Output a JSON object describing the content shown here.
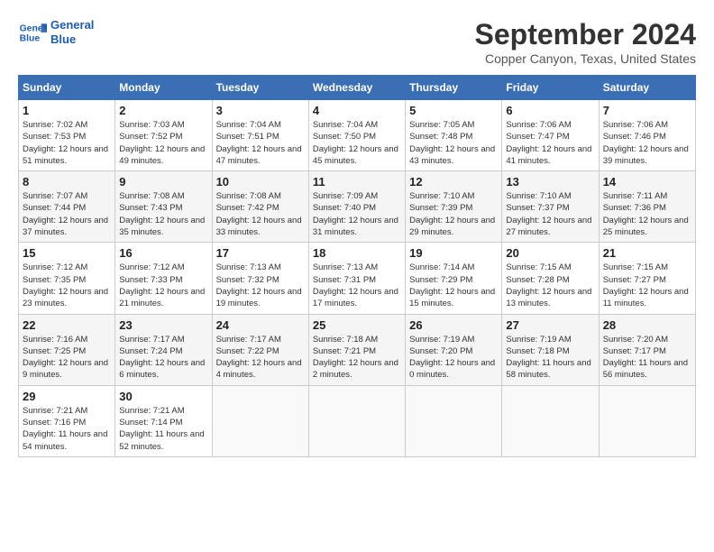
{
  "header": {
    "logo_line1": "General",
    "logo_line2": "Blue",
    "title": "September 2024",
    "location": "Copper Canyon, Texas, United States"
  },
  "days_of_week": [
    "Sunday",
    "Monday",
    "Tuesday",
    "Wednesday",
    "Thursday",
    "Friday",
    "Saturday"
  ],
  "weeks": [
    [
      {
        "num": "1",
        "sunrise": "7:02 AM",
        "sunset": "7:53 PM",
        "daylight": "12 hours and 51 minutes."
      },
      {
        "num": "2",
        "sunrise": "7:03 AM",
        "sunset": "7:52 PM",
        "daylight": "12 hours and 49 minutes."
      },
      {
        "num": "3",
        "sunrise": "7:04 AM",
        "sunset": "7:51 PM",
        "daylight": "12 hours and 47 minutes."
      },
      {
        "num": "4",
        "sunrise": "7:04 AM",
        "sunset": "7:50 PM",
        "daylight": "12 hours and 45 minutes."
      },
      {
        "num": "5",
        "sunrise": "7:05 AM",
        "sunset": "7:48 PM",
        "daylight": "12 hours and 43 minutes."
      },
      {
        "num": "6",
        "sunrise": "7:06 AM",
        "sunset": "7:47 PM",
        "daylight": "12 hours and 41 minutes."
      },
      {
        "num": "7",
        "sunrise": "7:06 AM",
        "sunset": "7:46 PM",
        "daylight": "12 hours and 39 minutes."
      }
    ],
    [
      {
        "num": "8",
        "sunrise": "7:07 AM",
        "sunset": "7:44 PM",
        "daylight": "12 hours and 37 minutes."
      },
      {
        "num": "9",
        "sunrise": "7:08 AM",
        "sunset": "7:43 PM",
        "daylight": "12 hours and 35 minutes."
      },
      {
        "num": "10",
        "sunrise": "7:08 AM",
        "sunset": "7:42 PM",
        "daylight": "12 hours and 33 minutes."
      },
      {
        "num": "11",
        "sunrise": "7:09 AM",
        "sunset": "7:40 PM",
        "daylight": "12 hours and 31 minutes."
      },
      {
        "num": "12",
        "sunrise": "7:10 AM",
        "sunset": "7:39 PM",
        "daylight": "12 hours and 29 minutes."
      },
      {
        "num": "13",
        "sunrise": "7:10 AM",
        "sunset": "7:37 PM",
        "daylight": "12 hours and 27 minutes."
      },
      {
        "num": "14",
        "sunrise": "7:11 AM",
        "sunset": "7:36 PM",
        "daylight": "12 hours and 25 minutes."
      }
    ],
    [
      {
        "num": "15",
        "sunrise": "7:12 AM",
        "sunset": "7:35 PM",
        "daylight": "12 hours and 23 minutes."
      },
      {
        "num": "16",
        "sunrise": "7:12 AM",
        "sunset": "7:33 PM",
        "daylight": "12 hours and 21 minutes."
      },
      {
        "num": "17",
        "sunrise": "7:13 AM",
        "sunset": "7:32 PM",
        "daylight": "12 hours and 19 minutes."
      },
      {
        "num": "18",
        "sunrise": "7:13 AM",
        "sunset": "7:31 PM",
        "daylight": "12 hours and 17 minutes."
      },
      {
        "num": "19",
        "sunrise": "7:14 AM",
        "sunset": "7:29 PM",
        "daylight": "12 hours and 15 minutes."
      },
      {
        "num": "20",
        "sunrise": "7:15 AM",
        "sunset": "7:28 PM",
        "daylight": "12 hours and 13 minutes."
      },
      {
        "num": "21",
        "sunrise": "7:15 AM",
        "sunset": "7:27 PM",
        "daylight": "12 hours and 11 minutes."
      }
    ],
    [
      {
        "num": "22",
        "sunrise": "7:16 AM",
        "sunset": "7:25 PM",
        "daylight": "12 hours and 9 minutes."
      },
      {
        "num": "23",
        "sunrise": "7:17 AM",
        "sunset": "7:24 PM",
        "daylight": "12 hours and 6 minutes."
      },
      {
        "num": "24",
        "sunrise": "7:17 AM",
        "sunset": "7:22 PM",
        "daylight": "12 hours and 4 minutes."
      },
      {
        "num": "25",
        "sunrise": "7:18 AM",
        "sunset": "7:21 PM",
        "daylight": "12 hours and 2 minutes."
      },
      {
        "num": "26",
        "sunrise": "7:19 AM",
        "sunset": "7:20 PM",
        "daylight": "12 hours and 0 minutes."
      },
      {
        "num": "27",
        "sunrise": "7:19 AM",
        "sunset": "7:18 PM",
        "daylight": "11 hours and 58 minutes."
      },
      {
        "num": "28",
        "sunrise": "7:20 AM",
        "sunset": "7:17 PM",
        "daylight": "11 hours and 56 minutes."
      }
    ],
    [
      {
        "num": "29",
        "sunrise": "7:21 AM",
        "sunset": "7:16 PM",
        "daylight": "11 hours and 54 minutes."
      },
      {
        "num": "30",
        "sunrise": "7:21 AM",
        "sunset": "7:14 PM",
        "daylight": "11 hours and 52 minutes."
      },
      null,
      null,
      null,
      null,
      null
    ]
  ]
}
